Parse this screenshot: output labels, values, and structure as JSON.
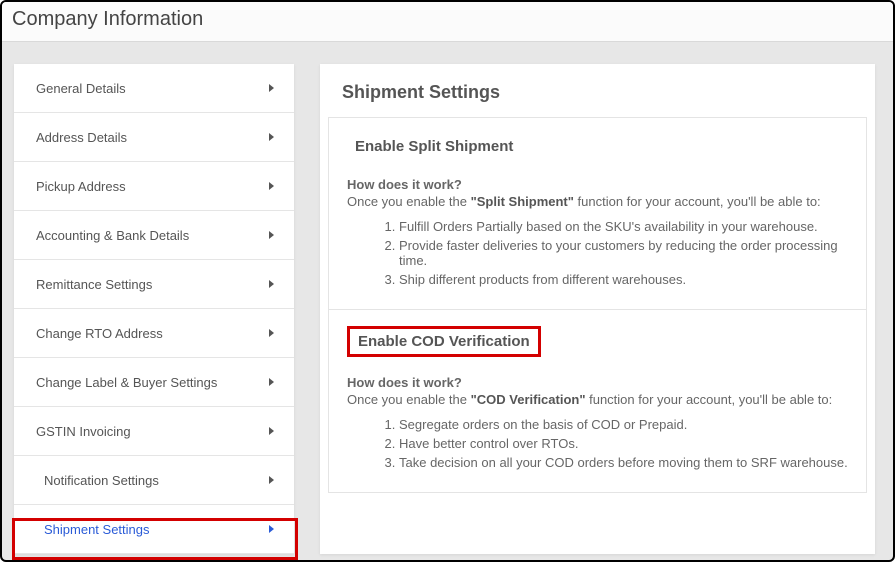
{
  "header": {
    "title": "Company Information"
  },
  "sidebar": {
    "items": [
      {
        "label": "General Details"
      },
      {
        "label": "Address Details"
      },
      {
        "label": "Pickup Address"
      },
      {
        "label": "Accounting & Bank Details"
      },
      {
        "label": "Remittance Settings"
      },
      {
        "label": "Change RTO Address"
      },
      {
        "label": "Change Label & Buyer Settings"
      },
      {
        "label": "GSTIN Invoicing"
      },
      {
        "label": "Notification Settings"
      },
      {
        "label": "Shipment Settings"
      }
    ]
  },
  "main": {
    "title": "Shipment Settings",
    "split": {
      "title": "Enable Split Shipment",
      "how_label": "How does it work?",
      "intro_pre": "Once you enable the ",
      "intro_bold": "\"Split Shipment\"",
      "intro_post": " function for your account, you'll be able to:",
      "points": [
        "Fulfill Orders Partially based on the SKU's availability in your warehouse.",
        "Provide faster deliveries to your customers by reducing the order processing time.",
        "Ship different products from different warehouses."
      ]
    },
    "cod": {
      "title": "Enable COD Verification",
      "how_label": "How does it work?",
      "intro_pre": "Once you enable the ",
      "intro_bold": "\"COD Verification\"",
      "intro_post": " function for your account, you'll be able to:",
      "points": [
        "Segregate orders on the basis of COD or Prepaid.",
        "Have better control over RTOs.",
        "Take decision on all your COD orders before moving them to SRF warehouse."
      ]
    }
  }
}
